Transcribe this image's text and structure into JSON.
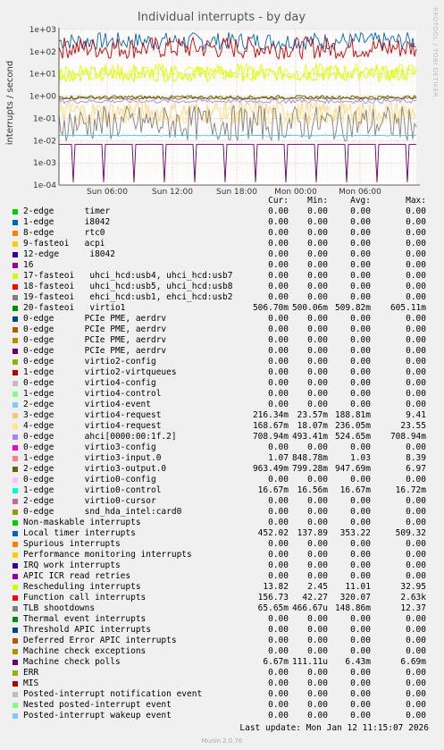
{
  "chart_data": {
    "type": "line",
    "title": "Individual interrupts - by day",
    "ylabel": "interrupts / second",
    "yscale": "log",
    "ylim": [
      0.0001,
      1000
    ],
    "yticks": [
      "1e+03",
      "1e+02",
      "1e+01",
      "1e+00",
      "1e-01",
      "1e-02",
      "1e-03",
      "1e-04"
    ],
    "xticks": [
      "Sun 06:00",
      "Sun 12:00",
      "Sun 18:00",
      "Mon 00:00",
      "Mon 06:00"
    ],
    "grid": true,
    "series": [
      {
        "name": "Local timer interrupts",
        "level": 300,
        "noise": 0.4,
        "color": "#0066b3"
      },
      {
        "name": "Function call interrupts",
        "level": 150,
        "noise": 0.5,
        "color": "#cc0000"
      },
      {
        "name": "17-fasteoi uhci_hcd:usb4, uhci_hcd:usb7",
        "level": 10,
        "noise": 0.35,
        "color": "#ccff00"
      },
      {
        "name": "Rescheduling interrupts",
        "level": 12,
        "noise": 0.4,
        "color": "#e5ff00"
      },
      {
        "name": "20-fasteoi virtio1",
        "level": 0.8,
        "noise": 0.05,
        "color": "#7a5b00"
      },
      {
        "name": "1-edge virtio3-input.0",
        "level": 0.9,
        "noise": 0.08,
        "color": "#5a5a00"
      },
      {
        "name": "0-edge ahci[0000:00:1f.2]",
        "level": 0.6,
        "noise": 0.1,
        "color": "#9988ee"
      },
      {
        "name": "3-edge virtio4-request",
        "level": 0.2,
        "noise": 0.5,
        "color": "#ffd27f"
      },
      {
        "name": "4-edge virtio4-request",
        "level": 0.15,
        "noise": 0.5,
        "color": "#ffe699"
      },
      {
        "name": "TLB shootdowns",
        "level": 0.06,
        "noise": 0.8,
        "color": "#808080"
      },
      {
        "name": "1-edge virtio0-control",
        "level": 0.017,
        "noise": 0.02,
        "color": "#33cccc"
      },
      {
        "name": "Machine check polls",
        "level": 0.0067,
        "noise": 0,
        "color": "#660066"
      }
    ],
    "columns": [
      "Cur:",
      "Min:",
      "Avg:",
      "Max:"
    ],
    "legend": [
      {
        "name": "2-edge      timer",
        "color": "#00cc00",
        "cur": "0.00",
        "min": "0.00",
        "avg": "0.00",
        "max": "0.00"
      },
      {
        "name": "1-edge      i8042",
        "color": "#0066b3",
        "cur": "0.00",
        "min": "0.00",
        "avg": "0.00",
        "max": "0.00"
      },
      {
        "name": "8-edge      rtc0",
        "color": "#ff8000",
        "cur": "0.00",
        "min": "0.00",
        "avg": "0.00",
        "max": "0.00"
      },
      {
        "name": "9-fasteoi   acpi",
        "color": "#ffcc00",
        "cur": "0.00",
        "min": "0.00",
        "avg": "0.00",
        "max": "0.00"
      },
      {
        "name": "12-edge      i8042",
        "color": "#330099",
        "cur": "0.00",
        "min": "0.00",
        "avg": "0.00",
        "max": "0.00"
      },
      {
        "name": "16",
        "color": "#990099",
        "cur": "0.00",
        "min": "0.00",
        "avg": "0.00",
        "max": "0.00"
      },
      {
        "name": "17-fasteoi   uhci_hcd:usb4, uhci_hcd:usb7",
        "color": "#ccff00",
        "cur": "0.00",
        "min": "0.00",
        "avg": "0.00",
        "max": "0.00"
      },
      {
        "name": "18-fasteoi   uhci_hcd:usb5, uhci_hcd:usb8",
        "color": "#ff0000",
        "cur": "0.00",
        "min": "0.00",
        "avg": "0.00",
        "max": "0.00"
      },
      {
        "name": "19-fasteoi   ehci_hcd:usb1, ehci_hcd:usb2",
        "color": "#808080",
        "cur": "0.00",
        "min": "0.00",
        "avg": "0.00",
        "max": "0.00"
      },
      {
        "name": "20-fasteoi   virtio1",
        "color": "#008f00",
        "cur": "506.70m",
        "min": "500.06m",
        "avg": "509.82m",
        "max": "605.11m"
      },
      {
        "name": "0-edge      PCIe PME, aerdrv",
        "color": "#00487d",
        "cur": "0.00",
        "min": "0.00",
        "avg": "0.00",
        "max": "0.00"
      },
      {
        "name": "0-edge      PCIe PME, aerdrv",
        "color": "#b35a00",
        "cur": "0.00",
        "min": "0.00",
        "avg": "0.00",
        "max": "0.00"
      },
      {
        "name": "0-edge      PCIe PME, aerdrv",
        "color": "#b38f00",
        "cur": "0.00",
        "min": "0.00",
        "avg": "0.00",
        "max": "0.00"
      },
      {
        "name": "0-edge      PCIe PME, aerdrv",
        "color": "#6b006b",
        "cur": "0.00",
        "min": "0.00",
        "avg": "0.00",
        "max": "0.00"
      },
      {
        "name": "0-edge      virtio2-config",
        "color": "#8fb300",
        "cur": "0.00",
        "min": "0.00",
        "avg": "0.00",
        "max": "0.00"
      },
      {
        "name": "1-edge      virtio2-virtqueues",
        "color": "#b30000",
        "cur": "0.00",
        "min": "0.00",
        "avg": "0.00",
        "max": "0.00"
      },
      {
        "name": "0-edge      virtio4-config",
        "color": "#bebebe",
        "cur": "0.00",
        "min": "0.00",
        "avg": "0.00",
        "max": "0.00"
      },
      {
        "name": "1-edge      virtio4-control",
        "color": "#80ff80",
        "cur": "0.00",
        "min": "0.00",
        "avg": "0.00",
        "max": "0.00"
      },
      {
        "name": "2-edge      virtio4-event",
        "color": "#80c9ff",
        "cur": "0.00",
        "min": "0.00",
        "avg": "0.00",
        "max": "0.00"
      },
      {
        "name": "3-edge      virtio4-request",
        "color": "#ffc080",
        "cur": "216.34m",
        "min": "23.57m",
        "avg": "188.81m",
        "max": "9.41"
      },
      {
        "name": "4-edge      virtio4-request",
        "color": "#ffe680",
        "cur": "168.67m",
        "min": "18.07m",
        "avg": "236.05m",
        "max": "23.55"
      },
      {
        "name": "0-edge      ahci[0000:00:1f.2]",
        "color": "#aa80ff",
        "cur": "708.94m",
        "min": "493.41m",
        "avg": "524.65m",
        "max": "708.94m"
      },
      {
        "name": "0-edge      virtio3-config",
        "color": "#ee00cc",
        "cur": "0.00",
        "min": "0.00",
        "avg": "0.00",
        "max": "0.00"
      },
      {
        "name": "1-edge      virtio3-input.0",
        "color": "#ff8080",
        "cur": "1.07",
        "min": "848.78m",
        "avg": "1.03",
        "max": "8.39"
      },
      {
        "name": "2-edge      virtio3-output.0",
        "color": "#666600",
        "cur": "963.49m",
        "min": "799.28m",
        "avg": "947.69m",
        "max": "6.97"
      },
      {
        "name": "0-edge      virtio0-config",
        "color": "#ffbfff",
        "cur": "0.00",
        "min": "0.00",
        "avg": "0.00",
        "max": "0.00"
      },
      {
        "name": "1-edge      virtio0-control",
        "color": "#00ffcc",
        "cur": "16.67m",
        "min": "16.56m",
        "avg": "16.67m",
        "max": "16.72m"
      },
      {
        "name": "2-edge      virtio0-cursor",
        "color": "#cc6699",
        "cur": "0.00",
        "min": "0.00",
        "avg": "0.00",
        "max": "0.00"
      },
      {
        "name": "0-edge      snd_hda_intel:card0",
        "color": "#999900",
        "cur": "0.00",
        "min": "0.00",
        "avg": "0.00",
        "max": "0.00"
      },
      {
        "name": "Non-maskable interrupts",
        "color": "#00cc00",
        "cur": "0.00",
        "min": "0.00",
        "avg": "0.00",
        "max": "0.00"
      },
      {
        "name": "Local timer interrupts",
        "color": "#0066b3",
        "cur": "452.02",
        "min": "137.89",
        "avg": "353.22",
        "max": "509.32"
      },
      {
        "name": "Spurious interrupts",
        "color": "#ff8000",
        "cur": "0.00",
        "min": "0.00",
        "avg": "0.00",
        "max": "0.00"
      },
      {
        "name": "Performance monitoring interrupts",
        "color": "#ffcc00",
        "cur": "0.00",
        "min": "0.00",
        "avg": "0.00",
        "max": "0.00"
      },
      {
        "name": "IRQ work interrupts",
        "color": "#330099",
        "cur": "0.00",
        "min": "0.00",
        "avg": "0.00",
        "max": "0.00"
      },
      {
        "name": "APIC ICR read retries",
        "color": "#990099",
        "cur": "0.00",
        "min": "0.00",
        "avg": "0.00",
        "max": "0.00"
      },
      {
        "name": "Rescheduling interrupts",
        "color": "#ccff00",
        "cur": "13.82",
        "min": "2.45",
        "avg": "11.01",
        "max": "32.95"
      },
      {
        "name": "Function call interrupts",
        "color": "#ff0000",
        "cur": "156.73",
        "min": "42.27",
        "avg": "320.07",
        "max": "2.63k"
      },
      {
        "name": "TLB shootdowns",
        "color": "#808080",
        "cur": "65.65m",
        "min": "466.67u",
        "avg": "148.86m",
        "max": "12.37"
      },
      {
        "name": "Thermal event interrupts",
        "color": "#008f00",
        "cur": "0.00",
        "min": "0.00",
        "avg": "0.00",
        "max": "0.00"
      },
      {
        "name": "Threshold APIC interrupts",
        "color": "#00487d",
        "cur": "0.00",
        "min": "0.00",
        "avg": "0.00",
        "max": "0.00"
      },
      {
        "name": "Deferred Error APIC interrupts",
        "color": "#b35a00",
        "cur": "0.00",
        "min": "0.00",
        "avg": "0.00",
        "max": "0.00"
      },
      {
        "name": "Machine check exceptions",
        "color": "#b38f00",
        "cur": "0.00",
        "min": "0.00",
        "avg": "0.00",
        "max": "0.00"
      },
      {
        "name": "Machine check polls",
        "color": "#6b006b",
        "cur": "6.67m",
        "min": "111.11u",
        "avg": "6.43m",
        "max": "6.69m"
      },
      {
        "name": "ERR",
        "color": "#8fb300",
        "cur": "0.00",
        "min": "0.00",
        "avg": "0.00",
        "max": "0.00"
      },
      {
        "name": "MIS",
        "color": "#b30000",
        "cur": "0.00",
        "min": "0.00",
        "avg": "0.00",
        "max": "0.00"
      },
      {
        "name": "Posted-interrupt notification event",
        "color": "#bebebe",
        "cur": "0.00",
        "min": "0.00",
        "avg": "0.00",
        "max": "0.00"
      },
      {
        "name": "Nested posted-interrupt event",
        "color": "#80ff80",
        "cur": "0.00",
        "min": "0.00",
        "avg": "0.00",
        "max": "0.00"
      },
      {
        "name": "Posted-interrupt wakeup event",
        "color": "#80c9ff",
        "cur": "0.00",
        "min": "0.00",
        "avg": "0.00",
        "max": "0.00"
      }
    ]
  },
  "footer": {
    "last_update": "Last update:  Mon Jan 12 11:15:07 2026",
    "munin_version": "Munin 2.0.76",
    "rrdtool_label": "RRDTOOL / TOBI OETIKER"
  }
}
